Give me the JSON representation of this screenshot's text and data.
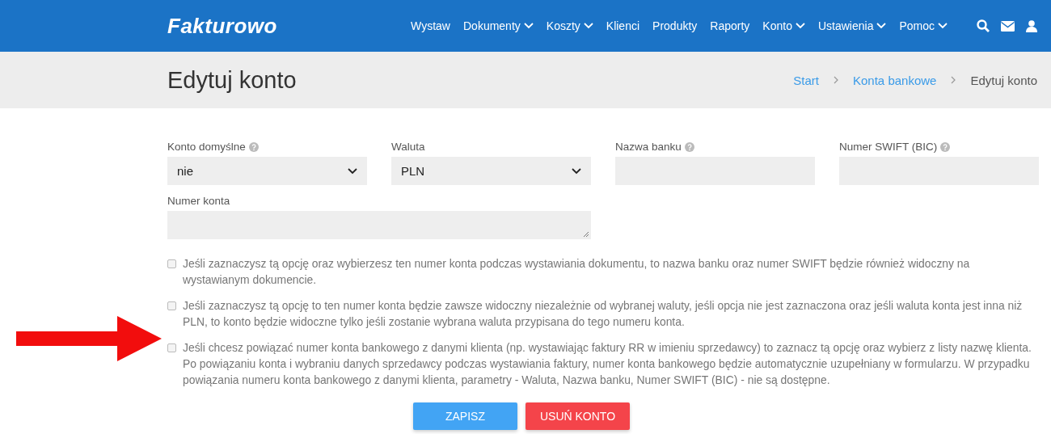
{
  "header": {
    "logo": "Fakturowo",
    "nav": [
      {
        "label": "Wystaw",
        "dropdown": false
      },
      {
        "label": "Dokumenty",
        "dropdown": true
      },
      {
        "label": "Koszty",
        "dropdown": true
      },
      {
        "label": "Klienci",
        "dropdown": false
      },
      {
        "label": "Produkty",
        "dropdown": false
      },
      {
        "label": "Raporty",
        "dropdown": false
      },
      {
        "label": "Konto",
        "dropdown": true
      },
      {
        "label": "Ustawienia",
        "dropdown": true
      },
      {
        "label": "Pomoc",
        "dropdown": true
      }
    ]
  },
  "page_title": "Edytuj konto",
  "breadcrumb": [
    {
      "label": "Start",
      "link": true
    },
    {
      "label": "Konta bankowe",
      "link": true
    },
    {
      "label": "Edytuj konto",
      "link": false
    }
  ],
  "fields": [
    {
      "kind": "select",
      "label": "Konto domyślne",
      "help": true,
      "value": "nie"
    },
    {
      "kind": "select",
      "label": "Waluta",
      "help": false,
      "value": "PLN"
    },
    {
      "kind": "text",
      "label": "Nazwa banku",
      "help": true
    },
    {
      "kind": "text",
      "label": "Numer SWIFT (BIC)",
      "help": true
    },
    {
      "kind": "textarea",
      "label": "Numer konta",
      "help": false
    }
  ],
  "options": [
    {
      "checked": false,
      "pointed": false,
      "text": "Jeśli zaznaczysz tą opcję oraz wybierzesz ten numer konta podczas wystawiania dokumentu, to nazwa banku oraz numer SWIFT będzie również widoczny na wystawianym dokumencie."
    },
    {
      "checked": false,
      "pointed": false,
      "text": "Jeśli zaznaczysz tą opcję to ten numer konta będzie zawsze widoczny niezależnie od wybranej waluty, jeśli opcja nie jest zaznaczona oraz jeśli waluta konta jest inna niż PLN, to konto będzie widoczne tylko jeśli zostanie wybrana waluta przypisana do tego numeru konta."
    },
    {
      "checked": false,
      "pointed": true,
      "text": "Jeśli chcesz powiązać numer konta bankowego z danymi klienta (np. wystawiając faktury RR w imieniu sprzedawcy) to zaznacz tą opcję oraz wybierz z listy nazwę klienta. Po powiązaniu konta i wybraniu danych sprzedawcy podczas wystawiania faktury, numer konta bankowego będzie automatycznie uzupełniany w formularzu. W przypadku powiązania numeru konta bankowego z danymi klienta, parametry - Waluta, Nazwa banku, Numer SWIFT (BIC) - nie są dostępne."
    }
  ],
  "buttons": [
    {
      "kind": "primary",
      "label": "ZAPISZ"
    },
    {
      "kind": "danger",
      "label": "USUŃ KONTO"
    }
  ]
}
